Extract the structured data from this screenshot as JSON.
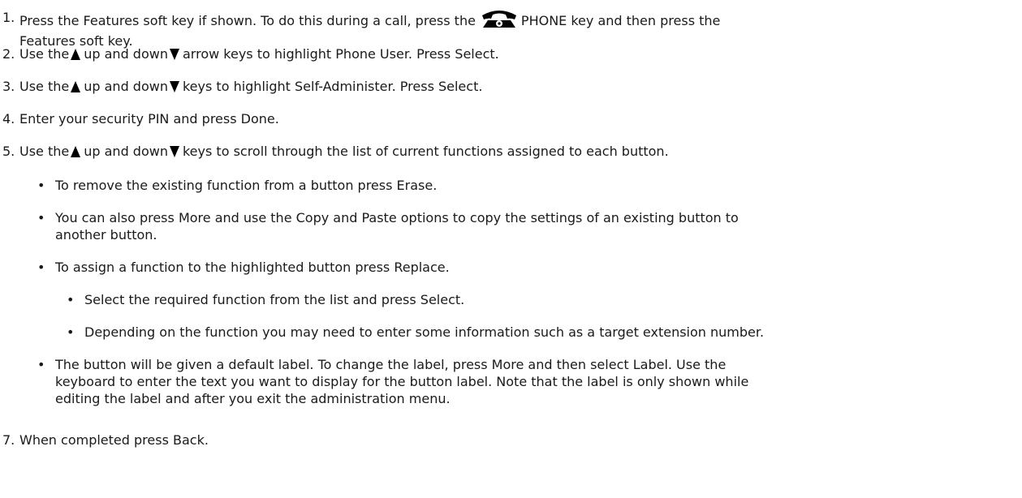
{
  "steps": {
    "s1": {
      "num": "1.",
      "a": "Press the Features soft key if shown. To do this during a call, press the",
      "b": "PHONE key and then press the",
      "c": "Features soft key."
    },
    "s2": {
      "num": "2.",
      "a": "Use the",
      "b": "up and down",
      "c": "arrow keys to highlight Phone User. Press Select."
    },
    "s3": {
      "num": "3.",
      "a": "Use the",
      "b": "up and down",
      "c": "keys to highlight Self-Administer. Press Select."
    },
    "s4": {
      "num": "4.",
      "a": "Enter your security PIN and press Done."
    },
    "s5": {
      "num": "5.",
      "a": "Use the",
      "b": "up and down",
      "c": "keys to scroll through the list of current functions assigned to each button."
    },
    "s7": {
      "num": "7.",
      "a": "When completed press Back."
    }
  },
  "bullets": {
    "erase": "To remove the existing function from a button press Erase.",
    "copy_a": "You can also press More and use the Copy and Paste options to copy the settings of an existing button to",
    "copy_b": "another button.",
    "replace": "To assign a function to the highlighted button press Replace.",
    "select_fn": "Select the required function from the list and press Select.",
    "depending": "Depending on the function you may need to enter some information such as a target extension number.",
    "label_a": "The button will be given a default label. To change the label, press More and then select Label. Use the",
    "label_b": "keyboard to enter the text you want to display for the button label. Note that the label is only shown while",
    "label_c": "editing the label and after you exit the administration menu."
  },
  "bullet_glyph": "•",
  "icons": {
    "phone": "phone-icon",
    "up": "up-arrow-icon",
    "down": "down-arrow-icon"
  },
  "colors": {
    "text": "#1a1a1a",
    "icon": "#000000"
  }
}
